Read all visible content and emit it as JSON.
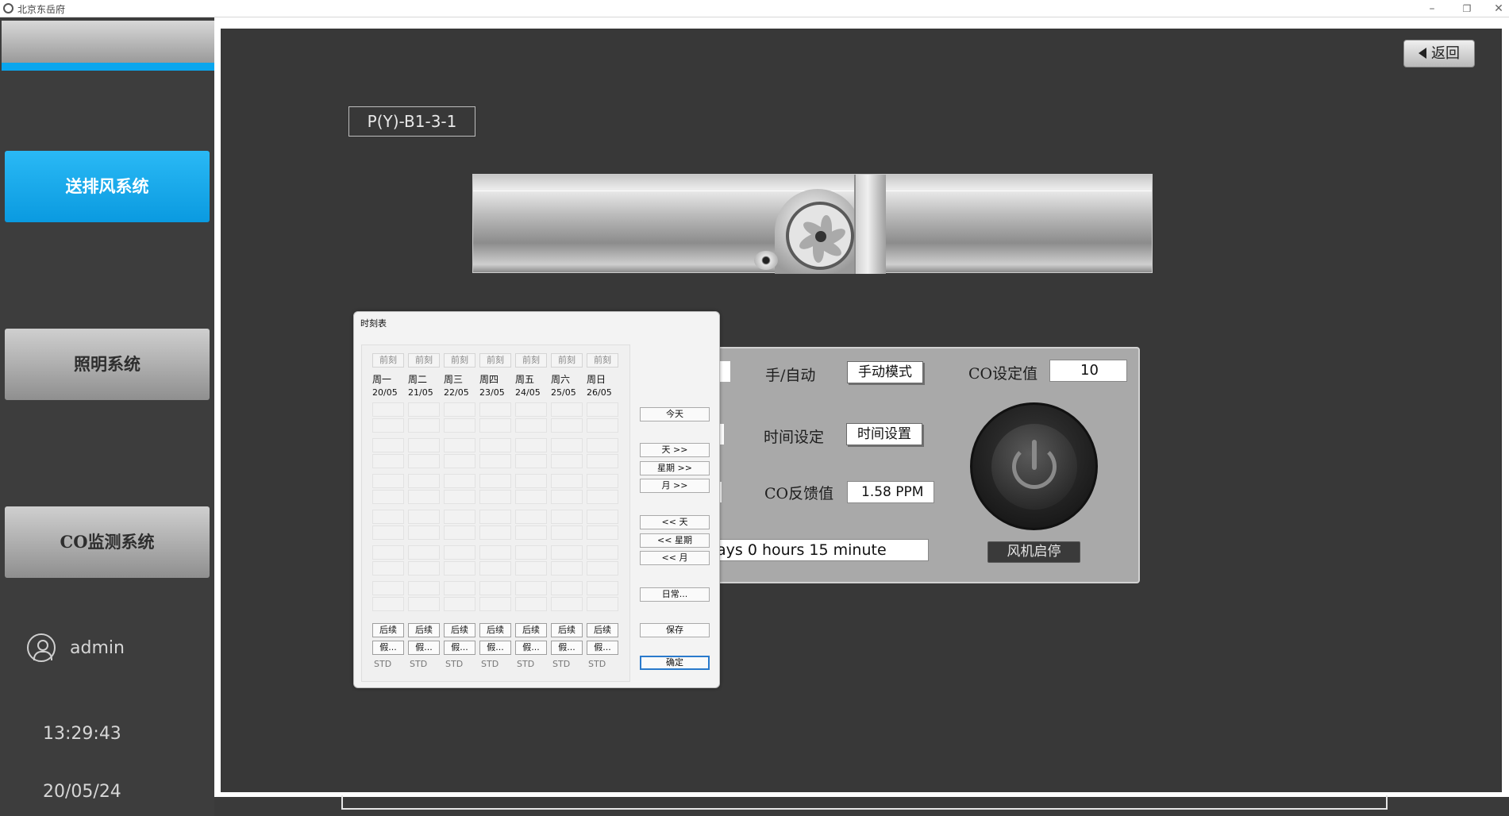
{
  "window": {
    "title": "北京东岳府",
    "minimize": "–",
    "maximize": "❐",
    "close": "✕"
  },
  "sidebar": {
    "nav": [
      {
        "label": "送排风系统",
        "active": true
      },
      {
        "label": "照明系统",
        "active": false
      },
      {
        "label": "CO监测系统",
        "active": false
      }
    ],
    "user": "admin",
    "time": "13:29:43",
    "date": "20/05/24"
  },
  "header": {
    "back_label": "返回"
  },
  "device": {
    "label": "P(Y)-B1-3-1"
  },
  "panel": {
    "mode_label": "手/自动",
    "mode_value": "手动模式",
    "time_label": "时间设定",
    "time_button": "时间设置",
    "co_feedback_label": "CO反馈值",
    "co_feedback_value": "1.58 PPM",
    "runtime_text": "ays 0 hours 15 minute",
    "co_set_label": "CO设定值",
    "co_set_value": "10",
    "fan_toggle_label": "风机启停"
  },
  "schedule": {
    "title": "时刻表",
    "prev_label": "前刻",
    "next_label": "后续",
    "holiday_label": "假...",
    "std_label": "STD",
    "days": [
      {
        "name": "周一",
        "date": "20/05"
      },
      {
        "name": "周二",
        "date": "21/05"
      },
      {
        "name": "周三",
        "date": "22/05"
      },
      {
        "name": "周四",
        "date": "23/05"
      },
      {
        "name": "周五",
        "date": "24/05"
      },
      {
        "name": "周六",
        "date": "25/05"
      },
      {
        "name": "周日",
        "date": "26/05"
      }
    ],
    "buttons": {
      "today": "今天",
      "day_next": "天 >>",
      "week_next": "星期 >>",
      "month_next": "月 >>",
      "day_prev": "<< 天",
      "week_prev": "<< 星期",
      "month_prev": "<< 月",
      "routine": "日常...",
      "save": "保存",
      "ok": "确定"
    }
  }
}
